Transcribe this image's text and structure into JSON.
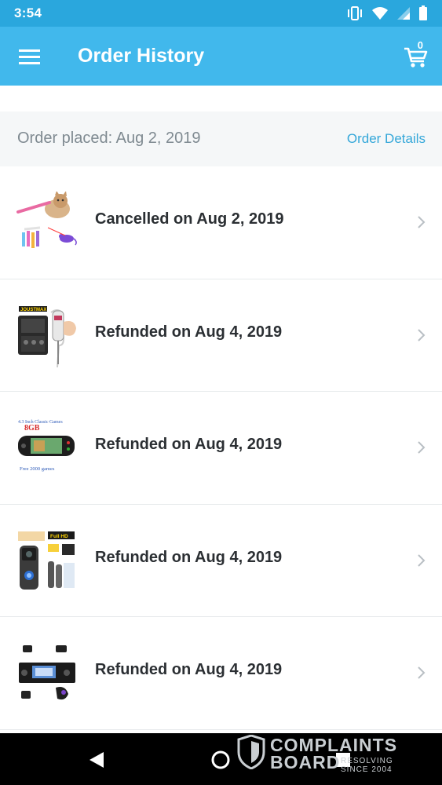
{
  "status_bar": {
    "time": "3:54",
    "icons": [
      "vibrate-icon",
      "wifi-icon",
      "signal-icon",
      "battery-icon"
    ]
  },
  "app_bar": {
    "title": "Order History",
    "menu_icon": "hamburger-menu-icon",
    "cart_icon": "shopping-cart-icon",
    "cart_count": "0",
    "background": "#41b8ec"
  },
  "order": {
    "placed_label": "Order placed: Aug 2, 2019",
    "details_link": "Order Details",
    "items": [
      {
        "status": "Cancelled on Aug 2, 2019",
        "thumbnail": "cat laser toy"
      },
      {
        "status": "Refunded on Aug 4, 2019",
        "thumbnail": "cordless screwdriver kit"
      },
      {
        "status": "Refunded on Aug 4, 2019",
        "thumbnail": "handheld game console"
      },
      {
        "status": "Refunded on Aug 4, 2019",
        "thumbnail": "video doorbell"
      },
      {
        "status": "Refunded on Aug 4, 2019",
        "thumbnail": "car stereo with camera"
      }
    ]
  },
  "thumbnail_text": {
    "console_line1": "4.3 Inch Classic Games",
    "console_line2": "8GB",
    "console_line3": "Free 2000 games",
    "screwdriver_brand": "JOUSTMAX",
    "doorbell_badge": "Full HD"
  },
  "watermark": {
    "line1": "COMPLAINTS",
    "line2": "BOARD",
    "line3": "RESOLVING SINCE 2004"
  },
  "nav_bar": {
    "icons": [
      "back-icon",
      "home-icon",
      "recents-icon"
    ]
  },
  "colors": {
    "status_bar": "#2aa7dd",
    "accent": "#34a7d9",
    "header_bg": "#f5f7f8"
  }
}
